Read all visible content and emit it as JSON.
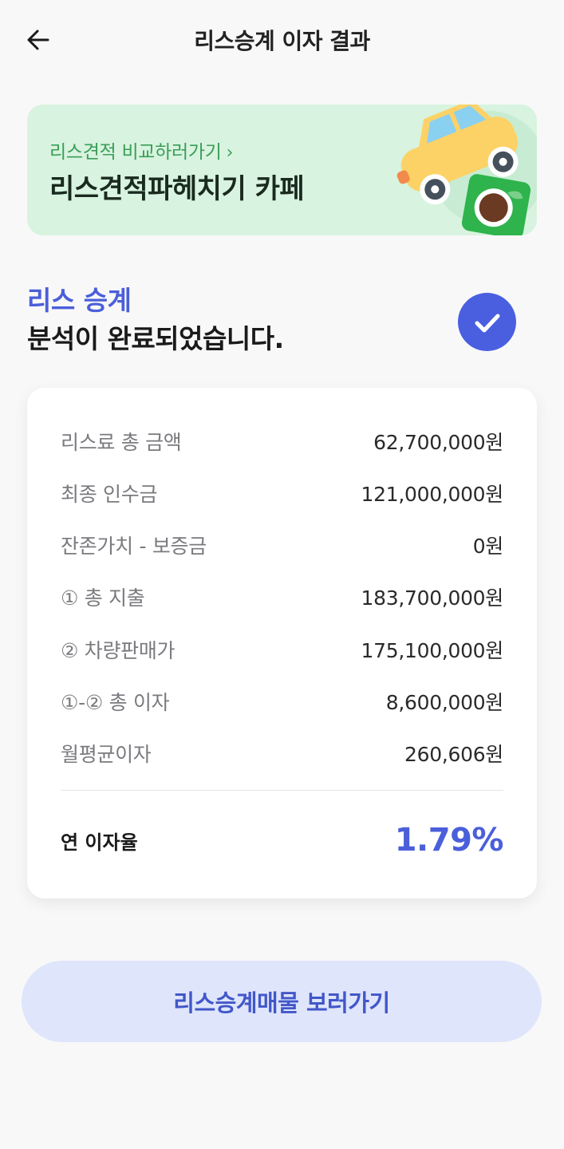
{
  "header": {
    "title": "리스승계 이자 결과",
    "back_icon": "arrow-left-icon"
  },
  "banner": {
    "link_label": "리스견적 비교하러가기",
    "chevron": "›",
    "title": "리스견적파헤치기 카페",
    "background": "#d8f3df",
    "art": [
      "car-illustration",
      "cafe-coffee-icon"
    ]
  },
  "result": {
    "accent": "리스 승계",
    "message": "분석이 완료되었습니다.",
    "status_icon": "check-circle-icon",
    "accent_color": "#4a5fd9"
  },
  "details": {
    "rows": [
      {
        "label": "리스료 총 금액",
        "value": "62,700,000원"
      },
      {
        "label": "최종 인수금",
        "value": "121,000,000원"
      },
      {
        "label": "잔존가치 - 보증금",
        "value": "0원"
      },
      {
        "label": "① 총 지출",
        "value": "183,700,000원"
      },
      {
        "label": "② 차량판매가",
        "value": "175,100,000원"
      },
      {
        "label": "①-② 총 이자",
        "value": "8,600,000원"
      },
      {
        "label": "월평균이자",
        "value": "260,606원"
      }
    ],
    "rate_label": "연 이자율",
    "rate_value": "1.79%"
  },
  "cta": {
    "label": "리스승계매물 보러가기",
    "background": "#dfe5fb"
  }
}
